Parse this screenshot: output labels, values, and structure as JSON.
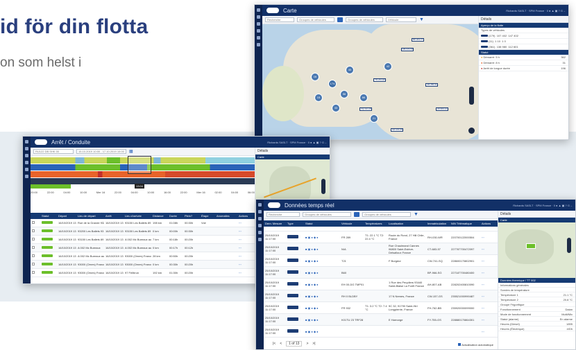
{
  "hero": {
    "title": "id för din flotta",
    "subtitle": "on som helst i"
  },
  "map_window": {
    "title": "Carte",
    "top_right": "Richards SASLT · SPM France · 0 ● ▲ ▣ ? G→",
    "search_placeholder": "Recherche",
    "group_select": "Groupes de véhicules",
    "group_select2": "Groupes de véhicules",
    "vehicle_select": "Véhicule",
    "checkboxes": [
      "Zones",
      "Grouper les véhicules",
      "Ouvrir sidebarl que"
    ],
    "details_title": "Détails",
    "details_bar": "Aperçu de la flotte",
    "types_label": "Types de véhicules",
    "type_rows": [
      {
        "code": "(179)",
        "a": "107",
        "b": "402",
        "c": "147",
        "d": "402"
      },
      {
        "code": "(11)",
        "a": "1",
        "b": "10",
        "c": "1",
        "d": "0"
      },
      {
        "code": "(361)",
        "a": "138",
        "b": "980",
        "c": "112",
        "d": "601"
      }
    ],
    "status_bar": "Statut",
    "status_rows": [
      {
        "label": "Démarré: 5 h",
        "value": "362"
      },
      {
        "label": "Démarré: 8 h",
        "value": "31"
      },
      {
        "label": "Arrêt de longue durée",
        "value": "196"
      }
    ],
    "cluster_pins": [
      "174",
      "40",
      "56",
      "33",
      "66",
      "42",
      "15",
      "21",
      "16"
    ],
    "vehicle_labels": [
      "AB-123-CD",
      "TR-234-EF",
      "AR-456-GH",
      "TQ-112-LB",
      "ZZ-900-AA",
      "GR-101-PM",
      "BP-003-TT"
    ]
  },
  "stop_window": {
    "title": "Arrêt / Conduite",
    "top_right": "Richards SASLT · SPM France · 0 ● ▲ ▣ ? G→",
    "vehicle_input": "RU122 DB SHK 00",
    "date_range": "15.10.2019 10:00 - 17.10.2019 10:00",
    "details_title": "Détails",
    "details_bar": "Carte",
    "time_ticks": [
      "20:00",
      "22:00",
      "04:00",
      "10:00",
      "Mer 16",
      "22:00",
      "04:00",
      "10:00",
      "16:00",
      "22:00",
      "Mer 16",
      "02:00",
      "04:00",
      "06:00"
    ],
    "table_headers": [
      "Statut",
      "Départ",
      "Lieu de départ",
      "Arrêt",
      "Lieu d'arrivée",
      "Distance",
      "Durée",
      "Plein?",
      "Étape",
      "Anomalies",
      "Actions"
    ],
    "rows": [
      {
        "dep": "16/10/2019 13:06:00",
        "from": "Rue de la Grande 93200 Chatigny",
        "arr": "16/10/2019 13:46:00",
        "to": "93150 Les Ballets 89 Enmes, France",
        "dist": "198 km",
        "dur": "01:08h",
        "plein": "00:30h",
        "etape": "Voir"
      },
      {
        "dep": "16/10/2019 13:06:00",
        "from": "93200 Les Ballets 93 Enmes, France",
        "arr": "16/10/2019 13:46:00",
        "to": "93150 Les Ballets 89 Enmes, France",
        "dist": "0 km",
        "dur": "00:00h",
        "plein": "00:30h",
        "etape": ""
      },
      {
        "dep": "16/10/2019 13:06:00",
        "from": "93150 Les Ballets 89 Enmes, France",
        "arr": "16/10/2019 13:46:00",
        "to": "A 002 Mc Bureaux aux fort",
        "dist": "7 km",
        "dur": "00:18h",
        "plein": "00:20h",
        "etape": ""
      },
      {
        "dep": "16/10/2019 13:06:00",
        "from": "A 002 Mc Bureaux",
        "arr": "16/10/2019 13:46:00",
        "to": "A 002 Mc Bureaux aux fort",
        "dist": "0 km",
        "dur": "00:17h",
        "plein": "00:12h",
        "etape": ""
      },
      {
        "dep": "16/10/2019 13:06:00",
        "from": "A 002 Mc Bureaux aux fort",
        "arr": "16/10/2019 13:46:00",
        "to": "93000 (Ornes) France",
        "dist": "28 km",
        "dur": "00:50h",
        "plein": "00:20h",
        "etape": ""
      },
      {
        "dep": "16/10/2019 13:06:00",
        "from": "93000 (Ornes) France",
        "arr": "16/10/2019 13:46:00",
        "to": "93000 (Ornes) France",
        "dist": "0 km",
        "dur": "00:30h",
        "plein": "00:20h",
        "etape": ""
      },
      {
        "dep": "16/10/2019 13:06:00",
        "from": "93000 (Ornes) France",
        "arr": "16/10/2019 13:46:00",
        "to": "97 Fellbrun",
        "dist": "192 km",
        "dur": "01:30h",
        "plein": "00:20h",
        "etape": ""
      }
    ],
    "timeline_tooltip": "13:04"
  },
  "realtime_window": {
    "title": "Données temps réel",
    "top_right": "Richards SASLT · SPM France · 0 ● ▲ ▣ ? G→",
    "search_placeholder": "Recherche",
    "group_select": "Groupes de véhicules",
    "group_select2": "Groupes de véhicules",
    "table_headers": [
      "Dern. Mesure",
      "Type",
      "Statut",
      "Véhicule",
      "Températures",
      "Localisation",
      "Immatriculation",
      "N/N Télématique",
      "Actions"
    ],
    "rows": [
      {
        "date": "25/10/2019 11:17:00",
        "veh": "FR 289",
        "temp": "T1: 22.1 °C T2: 22.4 °C",
        "loc": "Route du Rond, 27 Hill Chile, France",
        "immat": "RH-030-WR",
        "tele": "220700122000504"
      },
      {
        "date": "25/10/2019 11:17:00",
        "veh": "N/A",
        "temp": "",
        "loc": "Rue Chaulmand Cannes 06800 Saint-Estève-Delsalloux France",
        "immat": "CT-683-57",
        "tele": "227787700472097"
      },
      {
        "date": "25/10/2019 11:17:00",
        "veh": "T21",
        "temp": "",
        "loc": "F Burgdor",
        "immat": "CW-741-SQ",
        "tele": "228600170802901"
      },
      {
        "date": "25/10/2019 11:17:00",
        "veh": "B60",
        "temp": "",
        "loc": "",
        "immat": "BP-966-SG",
        "tele": "227187700480400"
      },
      {
        "date": "25/10/2019 11:17:00",
        "veh": "EH 00-DG TMP01",
        "temp": "",
        "loc": "1 Rue des Peupliers 93440 Saint-Blaise La Forêt France",
        "immat": "AH-807-AB",
        "tele": "228202400810090"
      },
      {
        "date": "25/10/2019 11:17:00",
        "veh": "RH 0 BLDBY",
        "temp": "",
        "loc": "17 N Nemes, France",
        "immat": "CW-157-GS",
        "tele": "235521000990487"
      },
      {
        "date": "25/10/2019 11:17:00",
        "veh": "FR 932",
        "temp": "T1: 3.2 °C T2: 7.4 °C",
        "loc": "9C 32, 91790 Saint-Hiri Longpierrie, France",
        "immat": "FH-762-BB",
        "tele": "235920000099000"
      },
      {
        "date": "25/10/2019 11:17:00",
        "veh": "K01TU 23 TRF28",
        "temp": "",
        "loc": "E Harnorge",
        "immat": "FY-755-GS",
        "tele": "228880170864301"
      },
      {
        "date": "25/10/2019 11:17:00",
        "veh": "",
        "temp": "",
        "loc": "",
        "immat": "",
        "tele": ""
      }
    ],
    "pager": "1 of 13",
    "auto_update": "Actualisation automatique",
    "details_title": "Détails",
    "details_bar": "Carte",
    "info_bar": "Données thermique / TT 002",
    "info_rows": [
      {
        "k": "Informations générales",
        "v": ""
      },
      {
        "k": "Sondes de température",
        "v": ""
      },
      {
        "k": "Température 1",
        "v": "21.1 °C"
      },
      {
        "k": "Température 2",
        "v": "20.8 °C"
      },
      {
        "k": "Groupe Frigorifique",
        "v": ""
      },
      {
        "k": "Fonctionnement",
        "v": "Dalan"
      },
      {
        "k": "Mode de fonctionnement",
        "v": "Multi/Mix"
      },
      {
        "k": "Statut (alarme)",
        "v": "En alarme"
      },
      {
        "k": "Heures (Diesel)",
        "v": "1895"
      },
      {
        "k": "Heures (Électrique)",
        "v": "4/Dh"
      }
    ]
  },
  "colors": {
    "navy": "#123067",
    "brand_title": "#2a3f7e",
    "accent_blue": "#2a63b8",
    "green": "#6cbf2a",
    "orange": "#e8632a",
    "band": "#e7edf2"
  }
}
